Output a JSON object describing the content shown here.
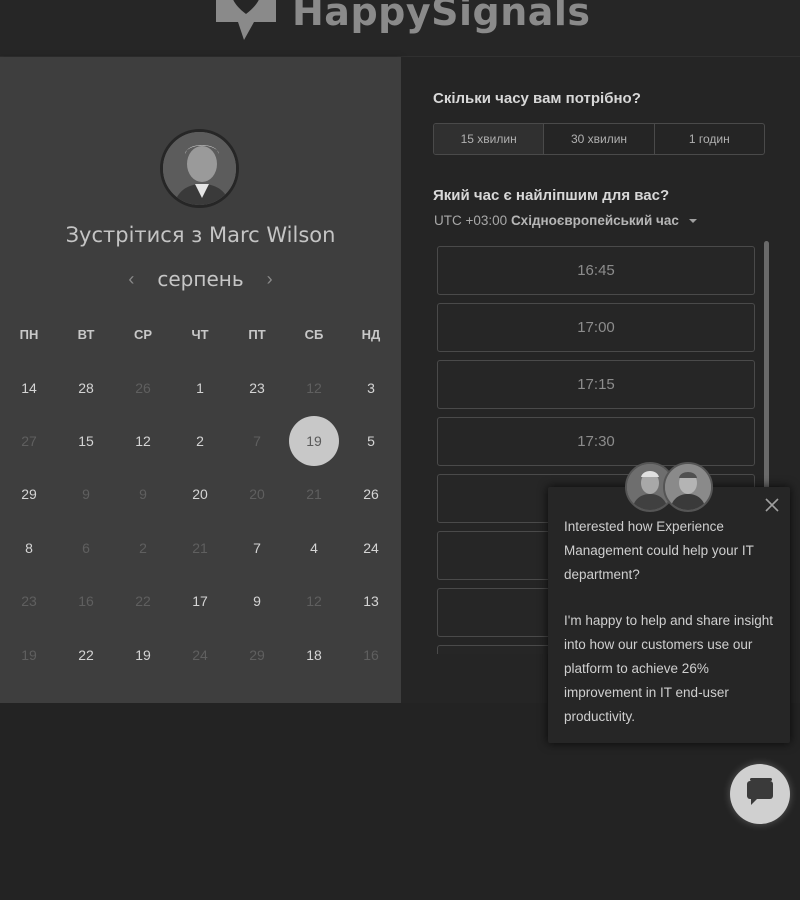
{
  "header": {
    "logo_text": "HappySignals"
  },
  "calendar": {
    "title": "Зустрітися з Marc Wilson",
    "month": "серпень",
    "weekdays": [
      "ПН",
      "ВТ",
      "СР",
      "ЧТ",
      "ПТ",
      "СБ",
      "НД"
    ],
    "weeks": [
      [
        {
          "d": "14",
          "on": true
        },
        {
          "d": "28",
          "on": true
        },
        {
          "d": "26",
          "on": false
        },
        {
          "d": "1",
          "on": true
        },
        {
          "d": "23",
          "on": true
        },
        {
          "d": "12",
          "on": false
        },
        {
          "d": "3",
          "on": true
        }
      ],
      [
        {
          "d": "27",
          "on": false
        },
        {
          "d": "15",
          "on": true
        },
        {
          "d": "12",
          "on": true
        },
        {
          "d": "2",
          "on": true
        },
        {
          "d": "7",
          "on": false
        },
        {
          "d": "19",
          "on": true,
          "selected": true
        },
        {
          "d": "5",
          "on": true
        }
      ],
      [
        {
          "d": "29",
          "on": true
        },
        {
          "d": "9",
          "on": false
        },
        {
          "d": "9",
          "on": false
        },
        {
          "d": "20",
          "on": true
        },
        {
          "d": "20",
          "on": false
        },
        {
          "d": "21",
          "on": false
        },
        {
          "d": "26",
          "on": true
        }
      ],
      [
        {
          "d": "8",
          "on": true
        },
        {
          "d": "6",
          "on": false
        },
        {
          "d": "2",
          "on": false
        },
        {
          "d": "21",
          "on": false
        },
        {
          "d": "7",
          "on": true
        },
        {
          "d": "4",
          "on": true
        },
        {
          "d": "24",
          "on": true
        }
      ],
      [
        {
          "d": "23",
          "on": false
        },
        {
          "d": "16",
          "on": false
        },
        {
          "d": "22",
          "on": false
        },
        {
          "d": "17",
          "on": true
        },
        {
          "d": "9",
          "on": true
        },
        {
          "d": "12",
          "on": false
        },
        {
          "d": "13",
          "on": true
        }
      ],
      [
        {
          "d": "19",
          "on": false
        },
        {
          "d": "22",
          "on": true
        },
        {
          "d": "19",
          "on": true
        },
        {
          "d": "24",
          "on": false
        },
        {
          "d": "29",
          "on": false
        },
        {
          "d": "18",
          "on": true
        },
        {
          "d": "16",
          "on": false
        }
      ]
    ]
  },
  "booking": {
    "duration_question": "Скільки часу вам потрібно?",
    "durations": [
      "15 хвилин",
      "30 хвилин",
      "1 годин"
    ],
    "selected_duration": "15 хвилин",
    "time_question": "Який час є найліпшим для вас?",
    "tz_offset": "UTC +03:00",
    "tz_name": "Східноєвропейський час",
    "slots": [
      "16:45",
      "17:00",
      "17:15",
      "17:30",
      "",
      "",
      "",
      ""
    ]
  },
  "chat": {
    "message_1": "Interested how Experience Management could help your IT department?",
    "message_2": "I'm happy to help and share insight into how our customers use our platform to achieve 26% improvement in IT end-user productivity."
  }
}
